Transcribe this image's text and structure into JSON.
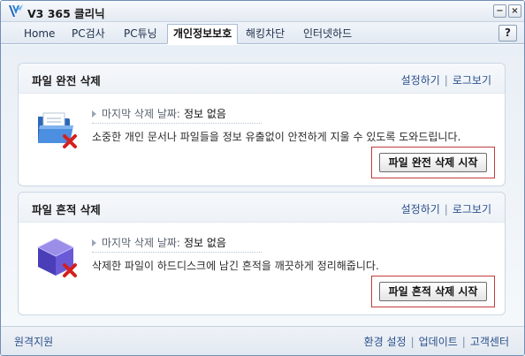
{
  "window": {
    "title": "V3 365 클리닉",
    "logo_icon": "v3-logo-icon",
    "minimize_label": "−",
    "close_label": "×"
  },
  "tabs": [
    {
      "label": "Home",
      "active": false
    },
    {
      "label": "PC검사",
      "active": false
    },
    {
      "label": "PC튜닝",
      "active": false
    },
    {
      "label": "개인정보보호",
      "active": true
    },
    {
      "label": "해킹차단",
      "active": false
    },
    {
      "label": "인터넷하드",
      "active": false
    }
  ],
  "help_label": "?",
  "panels": [
    {
      "title": "파일 완전 삭제",
      "links": [
        "설정하기",
        "로그보기"
      ],
      "last_label": "마지막 삭제 날짜:",
      "last_value": "정보 없음",
      "description": "소중한 개인 문서나 파일들을 정보 유출없이 안전하게 지울 수 있도록 도와드립니다.",
      "button": "파일 완전 삭제 시작",
      "icon": "folder-delete-icon"
    },
    {
      "title": "파일 흔적 삭제",
      "links": [
        "설정하기",
        "로그보기"
      ],
      "last_label": "마지막 삭제 날짜:",
      "last_value": "정보 없음",
      "description": "삭제한 파일이 하드디스크에 남긴 흔적을 깨끗하게 정리해줍니다.",
      "button": "파일 흔적 삭제 시작",
      "icon": "cube-delete-icon"
    }
  ],
  "footer": {
    "left": "원격지원",
    "right": [
      "환경 설정",
      "업데이트",
      "고객센터"
    ]
  },
  "colors": {
    "accent_link": "#2a4f8a",
    "highlight_border": "#c23c3c"
  }
}
